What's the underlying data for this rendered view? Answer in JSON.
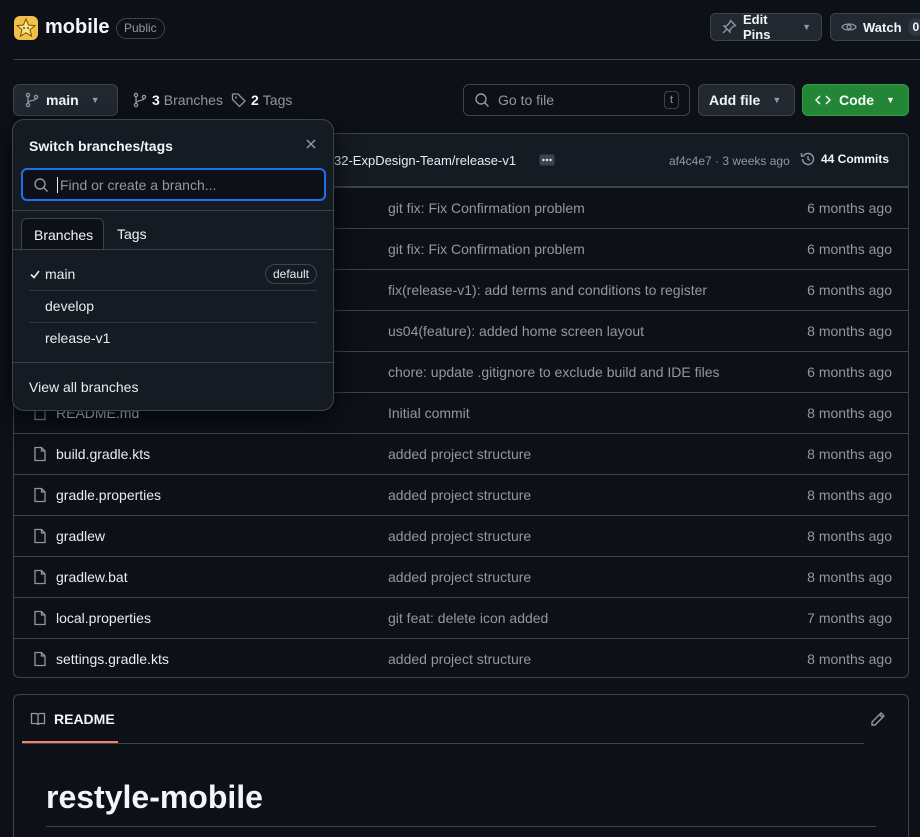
{
  "repo": {
    "name": "mobile",
    "visibility": "Public"
  },
  "header": {
    "edit_pins_label": "Edit Pins",
    "watch_label": "Watch",
    "watch_count": "0"
  },
  "branch_bar": {
    "current_branch": "main",
    "branches_count": "3",
    "branches_label": "Branches",
    "tags_count": "2",
    "tags_label": "Tags",
    "goto_file_placeholder": "Go to file",
    "goto_file_shortcut": "t",
    "add_file_label": "Add file",
    "code_label": "Code"
  },
  "latest_commit": {
    "message": "32-ExpDesign-Team/release-v1",
    "sha_time": "af4c4e7 · 3 weeks ago",
    "commits_label": "44 Commits"
  },
  "files": [
    {
      "name": "",
      "message": "git fix: Fix Confirmation problem",
      "date": "6 months ago"
    },
    {
      "name": "",
      "message": "git fix: Fix Confirmation problem",
      "date": "6 months ago"
    },
    {
      "name": "",
      "message": "fix(release-v1): add terms and conditions to register",
      "date": "6 months ago"
    },
    {
      "name": "",
      "message": "us04(feature): added home screen layout",
      "date": "8 months ago"
    },
    {
      "name": "",
      "message": "chore: update .gitignore to exclude build and IDE files",
      "date": "6 months ago"
    },
    {
      "name": "README.md",
      "message": "Initial commit",
      "date": "8 months ago"
    },
    {
      "name": "build.gradle.kts",
      "message": "added project structure",
      "date": "8 months ago"
    },
    {
      "name": "gradle.properties",
      "message": "added project structure",
      "date": "8 months ago"
    },
    {
      "name": "gradlew",
      "message": "added project structure",
      "date": "8 months ago"
    },
    {
      "name": "gradlew.bat",
      "message": "added project structure",
      "date": "8 months ago"
    },
    {
      "name": "local.properties",
      "message": "git feat: delete icon added",
      "date": "7 months ago"
    },
    {
      "name": "settings.gradle.kts",
      "message": "added project structure",
      "date": "8 months ago"
    }
  ],
  "readme": {
    "tab_label": "README",
    "title": "restyle-mobile"
  },
  "dropdown": {
    "title": "Switch branches/tags",
    "input_placeholder": "Find or create a branch...",
    "tab_branches": "Branches",
    "tab_tags": "Tags",
    "branches": [
      {
        "name": "main",
        "badge": "default",
        "selected": true
      },
      {
        "name": "develop",
        "badge": "",
        "selected": false
      },
      {
        "name": "release-v1",
        "badge": "",
        "selected": false
      }
    ],
    "view_all_label": "View all branches"
  },
  "colors": {
    "background": "#0d1117",
    "accent_green": "#238636",
    "focus_blue": "#1f6feb",
    "readme_underline": "#f78166"
  }
}
